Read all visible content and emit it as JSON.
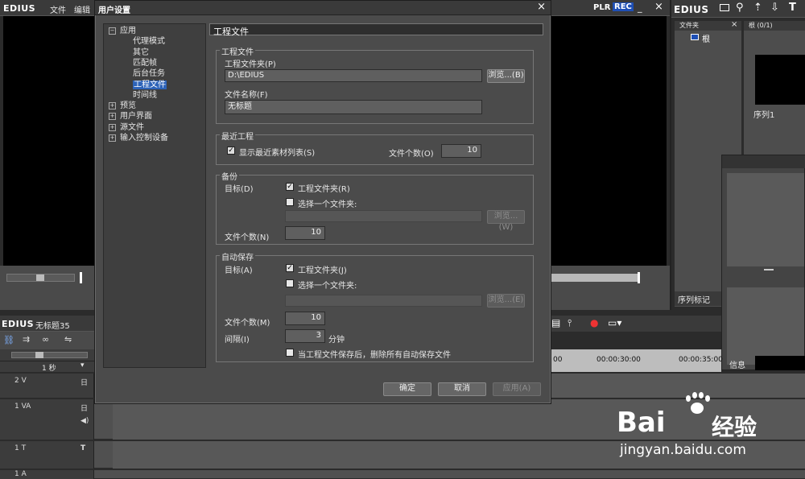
{
  "app": {
    "menu": [
      "EDIUS",
      "文件",
      "编辑"
    ],
    "player": {
      "plr": "PLR",
      "rec": "REC"
    },
    "right_logo": "EDIUS",
    "bin": {
      "folder_header": "文件夹",
      "folder_root": "根",
      "clip_header": "根 (0/1)",
      "clip_name": "序列1"
    },
    "sequence_tab": "序列标记",
    "info_tab": "信息",
    "timeline": {
      "logo": "EDIUS",
      "sequence_name": "无标题35",
      "scale": "1 秒",
      "timecodes": [
        "00",
        "00:00:30:00",
        "00:00:35:00"
      ],
      "tracks": [
        {
          "label": "2 V",
          "icon": "日"
        },
        {
          "label": "1 VA",
          "icon": "日"
        },
        {
          "label": "1 T",
          "icon": "T"
        },
        {
          "label": "1 A",
          "icon": ""
        }
      ]
    }
  },
  "dialog": {
    "title": "用户设置",
    "close": "×",
    "tree": [
      {
        "label": "应用",
        "toggle": "−",
        "level": 0
      },
      {
        "label": "代理模式",
        "level": 1
      },
      {
        "label": "其它",
        "level": 1
      },
      {
        "label": "匹配帧",
        "level": 1
      },
      {
        "label": "后台任务",
        "level": 1
      },
      {
        "label": "工程文件",
        "level": 1,
        "selected": true
      },
      {
        "label": "时间线",
        "level": 1
      },
      {
        "label": "预览",
        "toggle": "+",
        "level": 0
      },
      {
        "label": "用户界面",
        "toggle": "+",
        "level": 0
      },
      {
        "label": "源文件",
        "toggle": "+",
        "level": 0
      },
      {
        "label": "输入控制设备",
        "toggle": "+",
        "level": 0
      }
    ],
    "header": "工程文件",
    "project_file": {
      "group_title": "工程文件",
      "folder_label": "工程文件夹(P)",
      "folder_value": "D:\\EDIUS",
      "browse": "浏览...(B)",
      "name_label": "文件名称(F)",
      "name_value": "无标题"
    },
    "recent": {
      "group_title": "最近工程",
      "show_label": "显示最近素材列表(S)",
      "count_label": "文件个数(O)",
      "count_value": "10"
    },
    "backup": {
      "group_title": "备份",
      "target_label": "目标(D)",
      "project_folder": "工程文件夹(R)",
      "choose_folder": "选择一个文件夹:",
      "browse": "浏览...(W)",
      "count_label": "文件个数(N)",
      "count_value": "10"
    },
    "autosave": {
      "group_title": "自动保存",
      "target_label": "目标(A)",
      "project_folder": "工程文件夹(J)",
      "choose_folder": "选择一个文件夹:",
      "browse": "浏览...(E)",
      "count_label": "文件个数(M)",
      "count_value": "10",
      "interval_label": "间隔(I)",
      "interval_value": "3",
      "interval_unit": "分钟",
      "delete_label": "当工程文件保存后，删除所有自动保存文件"
    },
    "buttons": {
      "ok": "确定",
      "cancel": "取消",
      "apply": "应用(A)"
    }
  },
  "watermark": {
    "brand": "Bai",
    "brand_cn": "经验",
    "url": "jingyan.baidu.com"
  }
}
